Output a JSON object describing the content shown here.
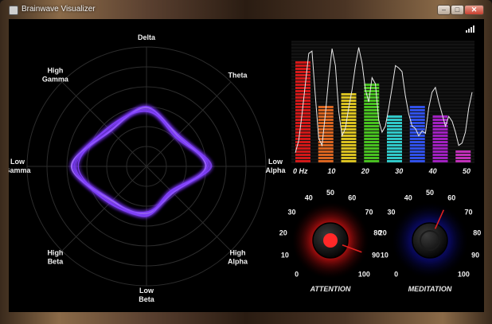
{
  "window": {
    "title": "Brainwave Visualizer",
    "minimize_glyph": "–",
    "maximize_glyph": "□",
    "close_glyph": "✕"
  },
  "radar": {
    "labels": [
      [
        "Delta"
      ],
      [
        "Theta"
      ],
      [
        "Low",
        "Alpha"
      ],
      [
        "High",
        "Alpha"
      ],
      [
        "Low",
        "Beta"
      ],
      [
        "High",
        "Beta"
      ],
      [
        "Low",
        "Gamma"
      ],
      [
        "High",
        "Gamma"
      ]
    ],
    "glow_color": "#7a3cff"
  },
  "spectrum": {
    "x_ticks": [
      "0 Hz",
      "10",
      "20",
      "30",
      "40",
      "50"
    ],
    "bars": [
      {
        "value": 0.84,
        "color": "#d01818"
      },
      {
        "value": 0.49,
        "color": "#d86420"
      },
      {
        "value": 0.59,
        "color": "#d8c020"
      },
      {
        "value": 0.66,
        "color": "#48c020"
      },
      {
        "value": 0.39,
        "color": "#30c8c8"
      },
      {
        "value": 0.49,
        "color": "#3050e8"
      },
      {
        "value": 0.4,
        "color": "#a020c0"
      },
      {
        "value": 0.1,
        "color": "#c030b8"
      }
    ],
    "trace_color": "#e8e8e8"
  },
  "gauges": [
    {
      "name": "attention",
      "caption": "ATTENTION",
      "ticks": [
        "0",
        "10",
        "20",
        "30",
        "40",
        "50",
        "60",
        "70",
        "80",
        "90",
        "100"
      ],
      "value": 91,
      "glow_color": "#ff2020"
    },
    {
      "name": "meditation",
      "caption": "MEDITATION",
      "ticks": [
        "0",
        "10",
        "20",
        "30",
        "40",
        "50",
        "60",
        "70",
        "80",
        "90",
        "100"
      ],
      "value": 59,
      "glow_color": "#1010c0"
    }
  ],
  "signal_icon": "signal-strength-icon"
}
